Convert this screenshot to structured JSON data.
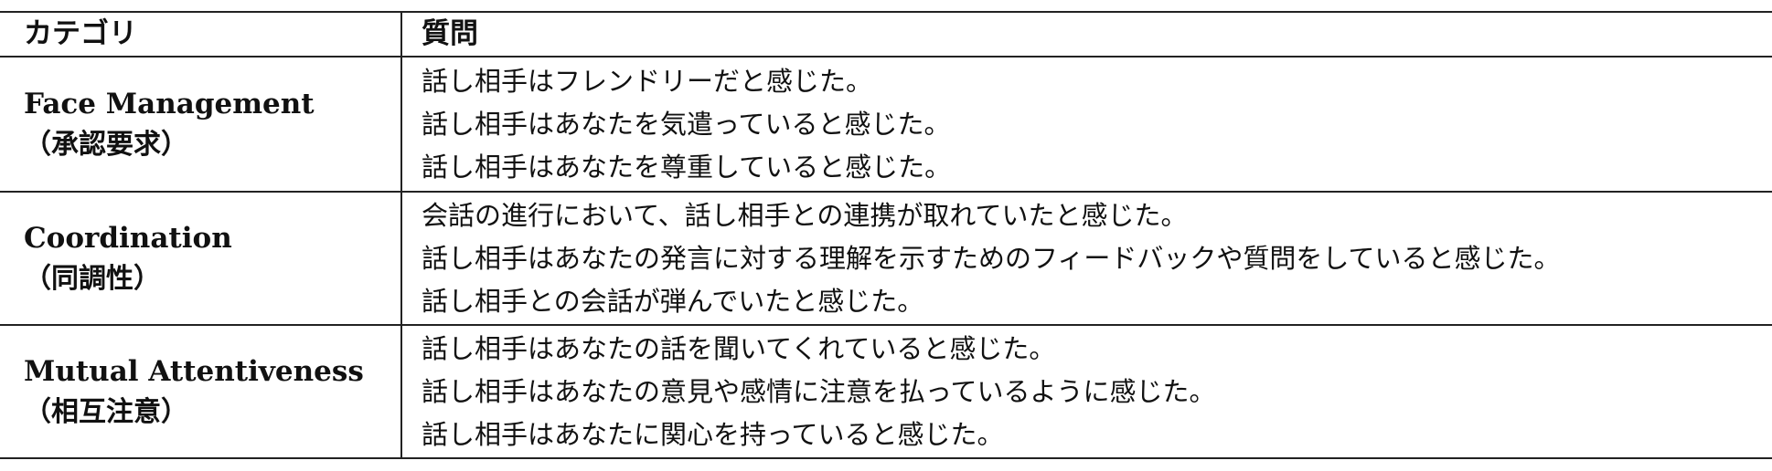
{
  "header": {
    "category_label": "カテゴリ",
    "question_label": "質問"
  },
  "groups": [
    {
      "category_en": "Face Management",
      "category_ja": "（承認要求）",
      "questions": [
        "話し相手はフレンドリーだと感じた。",
        "話し相手はあなたを気遣っていると感じた。",
        "話し相手はあなたを尊重していると感じた。"
      ]
    },
    {
      "category_en": "Coordination",
      "category_ja": "（同調性）",
      "questions": [
        "会話の進行において、話し相手との連携が取れていたと感じた。",
        "話し相手はあなたの発言に対する理解を示すためのフィードバックや質問をしていると感じた。",
        "話し相手との会話が弾んでいたと感じた。"
      ]
    },
    {
      "category_en": "Mutual Attentiveness",
      "category_ja": "（相互注意）",
      "questions": [
        "話し相手はあなたの話を聞いてくれていると感じた。",
        "話し相手はあなたの意見や感情に注意を払っているように感じた。",
        "話し相手はあなたに関心を持っていると感じた。"
      ]
    }
  ]
}
